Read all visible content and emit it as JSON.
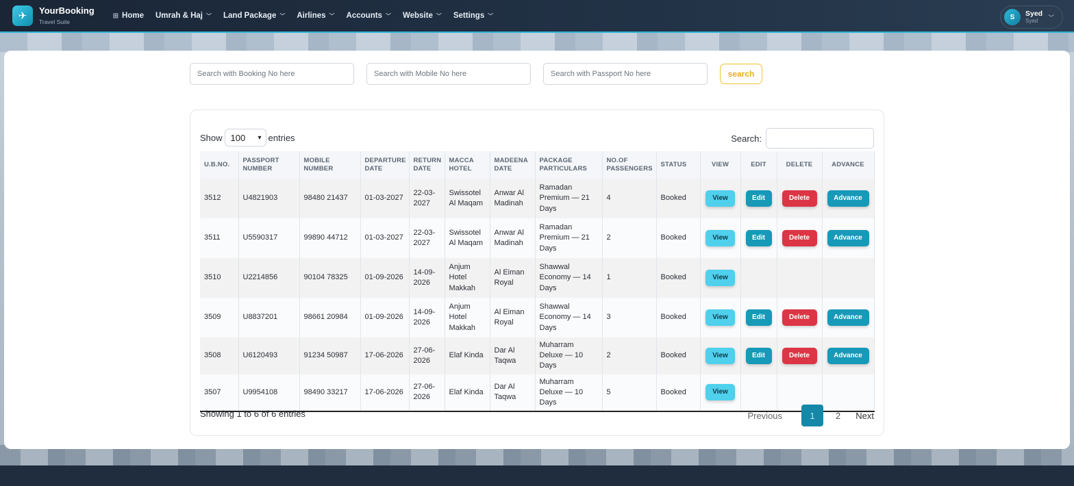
{
  "brand": {
    "name": "YourBooking",
    "subtitle": "Travel Suite",
    "logo_icon": "plane-icon"
  },
  "nav": {
    "home": "Home",
    "items": [
      "Umrah & Haj",
      "Land Package",
      "Airlines",
      "Accounts",
      "Website",
      "Settings"
    ]
  },
  "user": {
    "initial": "S",
    "name": "Syed",
    "role": "Syed"
  },
  "search": {
    "booking_placeholder": "Search with Booking No here",
    "mobile_placeholder": "Search with Mobile No here",
    "passport_placeholder": "Search with Passport No here",
    "button": "search"
  },
  "table": {
    "show_label": "Show",
    "entries_label": "entries",
    "page_size": "100",
    "search_label": "Search:",
    "headers": [
      "U.B.NO.",
      "PASSPORT NUMBER",
      "MOBILE NUMBER",
      "DEPARTURE DATE",
      "RETURN DATE",
      "MACCA HOTEL",
      "MADEENA DATE",
      "PACKAGE PARTICULARS",
      "NO.OF PASSENGERS",
      "STATUS",
      "VIEW",
      "EDIT",
      "DELETE",
      "ADVANCE"
    ],
    "buttons": {
      "view": "View",
      "edit": "Edit",
      "delete": "Delete",
      "advance": "Advance"
    },
    "rows": [
      {
        "ub": "3512",
        "passport": "U4821903",
        "mobile": "98480 21437",
        "dep": "01-03-2027",
        "ret": "22-03-2027",
        "hotel": "Swissotel Al Maqam",
        "madeena": "Anwar Al Madinah",
        "package": "Ramadan Premium — 21 Days",
        "pax": "4",
        "status": "Booked",
        "actions": true
      },
      {
        "ub": "3511",
        "passport": "U5590317",
        "mobile": "99890 44712",
        "dep": "01-03-2027",
        "ret": "22-03-2027",
        "hotel": "Swissotel Al Maqam",
        "madeena": "Anwar Al Madinah",
        "package": "Ramadan Premium — 21 Days",
        "pax": "2",
        "status": "Booked",
        "actions": true
      },
      {
        "ub": "3510",
        "passport": "U2214856",
        "mobile": "90104 78325",
        "dep": "01-09-2026",
        "ret": "14-09-2026",
        "hotel": "Anjum Hotel Makkah",
        "madeena": "Al Eiman Royal",
        "package": "Shawwal Economy — 14 Days",
        "pax": "1",
        "status": "Booked",
        "actions": false
      },
      {
        "ub": "3509",
        "passport": "U8837201",
        "mobile": "98661 20984",
        "dep": "01-09-2026",
        "ret": "14-09-2026",
        "hotel": "Anjum Hotel Makkah",
        "madeena": "Al Eiman Royal",
        "package": "Shawwal Economy — 14 Days",
        "pax": "3",
        "status": "Booked",
        "actions": true
      },
      {
        "ub": "3508",
        "passport": "U6120493",
        "mobile": "91234 50987",
        "dep": "17-06-2026",
        "ret": "27-06-2026",
        "hotel": "Elaf Kinda",
        "madeena": "Dar Al Taqwa",
        "package": "Muharram Deluxe — 10 Days",
        "pax": "2",
        "status": "Booked",
        "actions": true
      },
      {
        "ub": "3507",
        "passport": "U9954108",
        "mobile": "98490 33217",
        "dep": "17-06-2026",
        "ret": "27-06-2026",
        "hotel": "Elaf Kinda",
        "madeena": "Dar Al Taqwa",
        "package": "Muharram Deluxe — 10 Days",
        "pax": "5",
        "status": "Booked",
        "actions": false
      }
    ],
    "info": "Showing 1 to 6 of 6 entries",
    "pager": {
      "previous": "Previous",
      "pages": [
        "1",
        "2"
      ],
      "next": "Next"
    }
  }
}
